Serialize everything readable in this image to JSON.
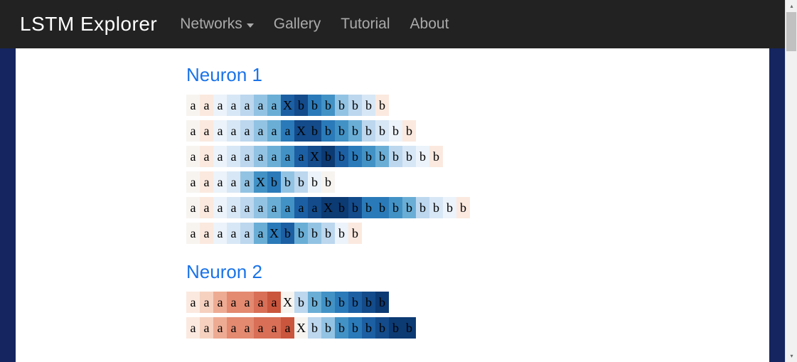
{
  "header": {
    "brand": "LSTM Explorer",
    "nav": {
      "networks": "Networks",
      "gallery": "Gallery",
      "tutorial": "Tutorial",
      "about": "About"
    }
  },
  "palette": {
    "neg5": "#c9563d",
    "neg4": "#d86f56",
    "neg3": "#e38a71",
    "neg2": "#eeab93",
    "neg1": "#f6d1c0",
    "neg0": "#fbe9df",
    "zero": "#f7f4f0",
    "pos0": "#ecf3fa",
    "pos1": "#d8e7f5",
    "pos2": "#bcd7ee",
    "pos3": "#93c3e3",
    "pos4": "#6aaed6",
    "pos5": "#4292c6",
    "pos6": "#2a7ab9",
    "pos7": "#1c5fa3",
    "pos8": "#134b8b",
    "pos9": "#0c3a73"
  },
  "sections": [
    {
      "title": "Neuron 1",
      "rows": [
        {
          "chars": [
            "a",
            "a",
            "a",
            "a",
            "a",
            "a",
            "a",
            "X",
            "b",
            "b",
            "b",
            "b",
            "b",
            "b",
            "b"
          ],
          "colors": [
            "zero",
            "neg0",
            "pos0",
            "pos1",
            "pos2",
            "pos3",
            "pos4",
            "pos7",
            "pos8",
            "pos6",
            "pos5",
            "pos3",
            "pos2",
            "pos1",
            "neg0"
          ]
        },
        {
          "chars": [
            "a",
            "a",
            "a",
            "a",
            "a",
            "a",
            "a",
            "a",
            "X",
            "b",
            "b",
            "b",
            "b",
            "b",
            "b",
            "b",
            "b"
          ],
          "colors": [
            "zero",
            "neg0",
            "pos0",
            "pos1",
            "pos2",
            "pos3",
            "pos4",
            "pos6",
            "pos8",
            "pos8",
            "pos6",
            "pos5",
            "pos4",
            "pos2",
            "pos1",
            "pos0",
            "neg0"
          ]
        },
        {
          "chars": [
            "a",
            "a",
            "a",
            "a",
            "a",
            "a",
            "a",
            "a",
            "a",
            "X",
            "b",
            "b",
            "b",
            "b",
            "b",
            "b",
            "b",
            "b",
            "b"
          ],
          "colors": [
            "zero",
            "neg0",
            "pos0",
            "pos1",
            "pos2",
            "pos3",
            "pos4",
            "pos5",
            "pos7",
            "pos8",
            "pos9",
            "pos7",
            "pos6",
            "pos5",
            "pos4",
            "pos2",
            "pos1",
            "pos0",
            "neg0"
          ]
        },
        {
          "chars": [
            "a",
            "a",
            "a",
            "a",
            "a",
            "X",
            "b",
            "b",
            "b",
            "b",
            "b"
          ],
          "colors": [
            "zero",
            "neg0",
            "pos0",
            "pos1",
            "pos3",
            "pos5",
            "pos6",
            "pos3",
            "pos2",
            "pos0",
            "zero"
          ]
        },
        {
          "chars": [
            "a",
            "a",
            "a",
            "a",
            "a",
            "a",
            "a",
            "a",
            "a",
            "a",
            "X",
            "b",
            "b",
            "b",
            "b",
            "b",
            "b",
            "b",
            "b",
            "b",
            "b"
          ],
          "colors": [
            "zero",
            "neg0",
            "pos0",
            "pos1",
            "pos2",
            "pos3",
            "pos4",
            "pos5",
            "pos7",
            "pos8",
            "pos9",
            "pos9",
            "pos8",
            "pos6",
            "pos6",
            "pos5",
            "pos4",
            "pos2",
            "pos1",
            "pos0",
            "neg0"
          ]
        },
        {
          "chars": [
            "a",
            "a",
            "a",
            "a",
            "a",
            "a",
            "X",
            "b",
            "b",
            "b",
            "b",
            "b",
            "b"
          ],
          "colors": [
            "zero",
            "neg0",
            "pos0",
            "pos1",
            "pos2",
            "pos4",
            "pos6",
            "pos7",
            "pos4",
            "pos3",
            "pos2",
            "pos0",
            "neg0"
          ]
        }
      ]
    },
    {
      "title": "Neuron 2",
      "rows": [
        {
          "chars": [
            "a",
            "a",
            "a",
            "a",
            "a",
            "a",
            "a",
            "X",
            "b",
            "b",
            "b",
            "b",
            "b",
            "b",
            "b"
          ],
          "colors": [
            "neg0",
            "neg1",
            "neg2",
            "neg3",
            "neg3",
            "neg4",
            "neg5",
            "zero",
            "pos2",
            "pos4",
            "pos5",
            "pos6",
            "pos7",
            "pos8",
            "pos9"
          ]
        },
        {
          "chars": [
            "a",
            "a",
            "a",
            "a",
            "a",
            "a",
            "a",
            "a",
            "X",
            "b",
            "b",
            "b",
            "b",
            "b",
            "b",
            "b",
            "b"
          ],
          "colors": [
            "neg0",
            "neg1",
            "neg2",
            "neg3",
            "neg3",
            "neg4",
            "neg4",
            "neg5",
            "zero",
            "pos2",
            "pos3",
            "pos5",
            "pos6",
            "pos7",
            "pos8",
            "pos9",
            "pos9"
          ]
        }
      ]
    }
  ]
}
